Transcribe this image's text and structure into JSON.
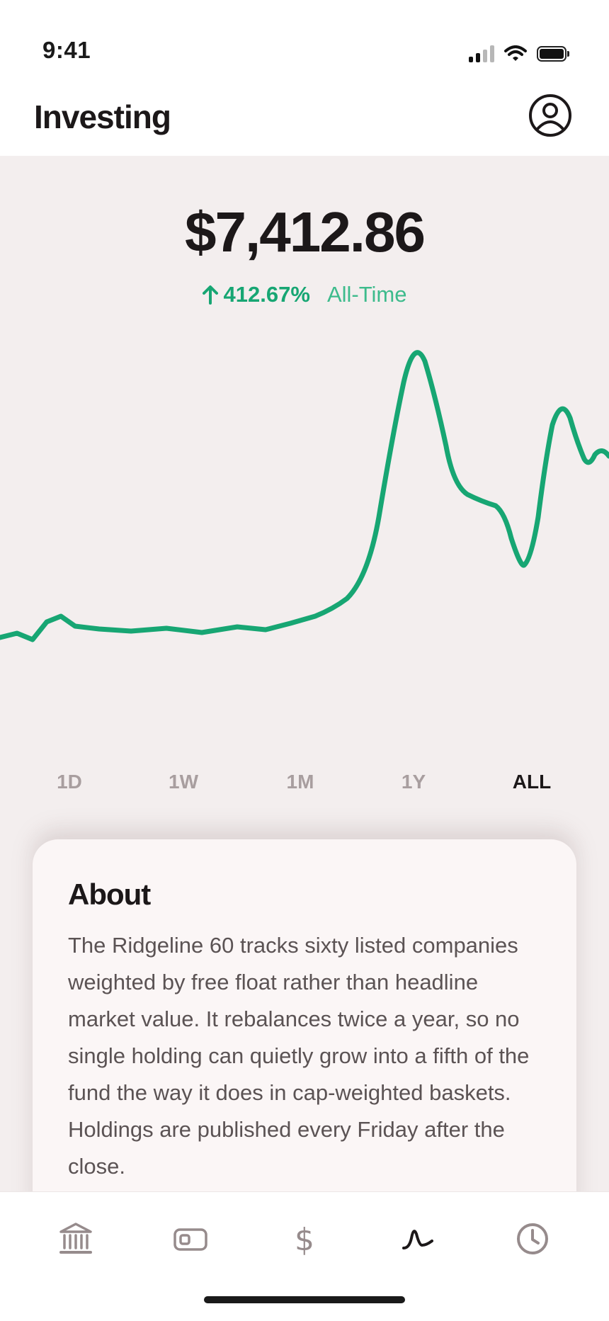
{
  "status_bar": {
    "time": "9:41"
  },
  "header": {
    "title": "Investing"
  },
  "portfolio": {
    "balance": "$7,412.86",
    "change_percent": "412.67%",
    "change_period": "All-Time",
    "trend": "up",
    "accent_color": "#17a673"
  },
  "ranges": [
    {
      "label": "1D",
      "active": false
    },
    {
      "label": "1W",
      "active": false
    },
    {
      "label": "1M",
      "active": false
    },
    {
      "label": "1Y",
      "active": false
    },
    {
      "label": "ALL",
      "active": true
    }
  ],
  "about": {
    "title": "About",
    "body": "The Ridgeline 60 tracks sixty listed companies weighted by free float rather than headline market value. It rebalances twice a year, so no single holding can quietly grow into a fifth of the fund the way it does in cap-weighted baskets. Holdings are published every Friday after the close."
  },
  "tab_bar": {
    "items": [
      {
        "icon": "bank-icon",
        "active": false
      },
      {
        "icon": "card-icon",
        "active": false
      },
      {
        "icon": "dollar-icon",
        "active": false
      },
      {
        "icon": "investing-icon",
        "active": true
      },
      {
        "icon": "clock-icon",
        "active": false
      }
    ]
  }
}
